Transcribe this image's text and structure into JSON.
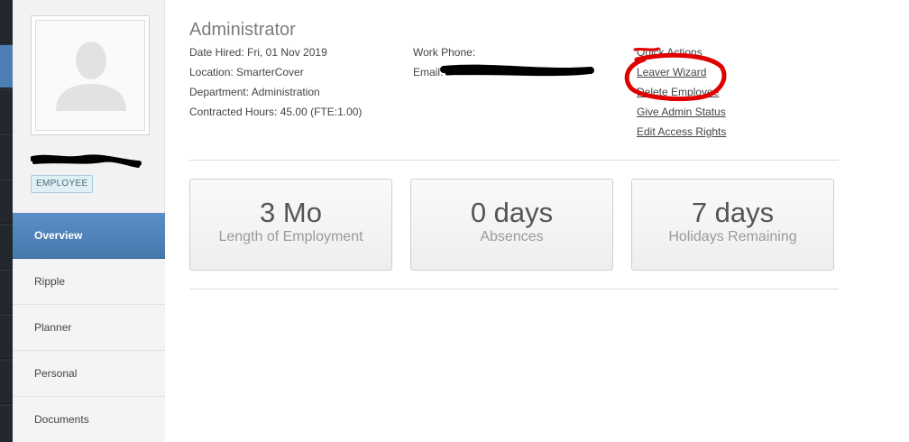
{
  "sidebar": {
    "badge": "EMPLOYEE",
    "items": [
      {
        "label": "Overview",
        "active": true
      },
      {
        "label": "Ripple"
      },
      {
        "label": "Planner"
      },
      {
        "label": "Personal"
      },
      {
        "label": "Documents"
      }
    ]
  },
  "profile": {
    "title": "Administrator",
    "date_hired": "Date Hired: Fri, 01 Nov 2019",
    "location": "Location: SmarterCover",
    "department": "Department: Administration",
    "contracted_hours": "Contracted Hours: 45.00 (FTE:1.00)",
    "work_phone": "Work Phone:",
    "email": "Email:"
  },
  "quick_actions": {
    "heading": "Quick Actions",
    "leaver_wizard": "Leaver Wizard",
    "delete_employee": "Delete Employee",
    "give_admin_status": "Give Admin Status",
    "edit_access_rights": "Edit Access Rights"
  },
  "stats": [
    {
      "value": "3 Mo",
      "label": "Length of Employment"
    },
    {
      "value": "0 days",
      "label": "Absences"
    },
    {
      "value": "7 days",
      "label": "Holidays Remaining"
    }
  ],
  "colors": {
    "accent": "#4d7fb4",
    "annotation": "#e00000",
    "redaction": "#000000"
  }
}
